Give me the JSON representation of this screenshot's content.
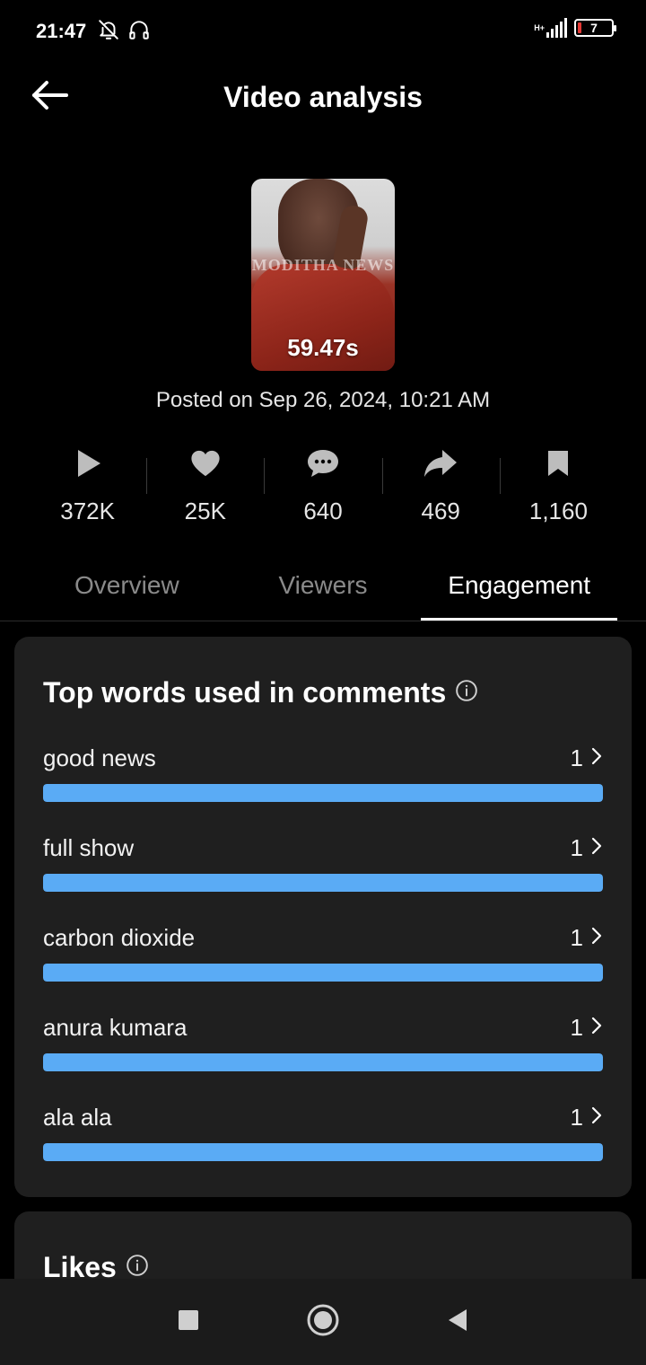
{
  "status_bar": {
    "time": "21:47",
    "network_label": "H+",
    "battery_level": "7"
  },
  "header": {
    "title": "Video analysis"
  },
  "video": {
    "duration": "59.47s",
    "watermark": "MODITHA NEWS",
    "posted": "Posted on Sep 26, 2024, 10:21 AM"
  },
  "stats": [
    {
      "icon": "play-icon",
      "value": "372K"
    },
    {
      "icon": "heart-icon",
      "value": "25K"
    },
    {
      "icon": "comment-icon",
      "value": "640"
    },
    {
      "icon": "share-icon",
      "value": "469"
    },
    {
      "icon": "bookmark-icon",
      "value": "1,160"
    }
  ],
  "tabs": [
    {
      "label": "Overview",
      "active": false
    },
    {
      "label": "Viewers",
      "active": false
    },
    {
      "label": "Engagement",
      "active": true
    }
  ],
  "top_words": {
    "title": "Top words used in comments",
    "items": [
      {
        "word": "good news",
        "count": "1",
        "fraction": 1.0
      },
      {
        "word": "full show",
        "count": "1",
        "fraction": 1.0
      },
      {
        "word": "carbon dioxide",
        "count": "1",
        "fraction": 1.0
      },
      {
        "word": "anura kumara",
        "count": "1",
        "fraction": 1.0
      },
      {
        "word": "ala ala",
        "count": "1",
        "fraction": 1.0
      }
    ],
    "bar_color": "#5aabf5"
  },
  "likes": {
    "title": "Likes"
  },
  "colors": {
    "background": "#000000",
    "card": "#1f1f1f",
    "accent": "#5aabf5",
    "inactive_tab": "#8a8a8a"
  }
}
